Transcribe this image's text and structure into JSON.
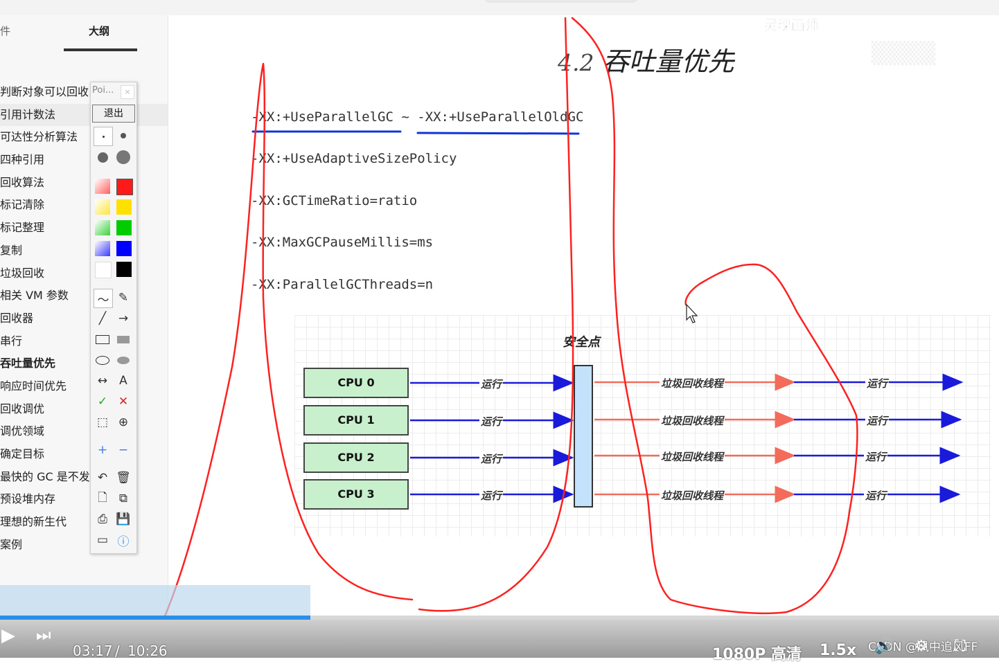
{
  "sidebar": {
    "tab_files": "件",
    "tab_outline": "大纲",
    "items": [
      "判断对象可以回收",
      "引用计数法",
      "可达性分析算法",
      "四种引用",
      "回收算法",
      "标记清除",
      "标记整理",
      "复制",
      "垃圾回收",
      "相关 VM 参数",
      "回收器",
      "串行",
      "吞吐量优先",
      "响应时间优先",
      "回收调优",
      "调优领域",
      "确定目标",
      "最快的 GC 是不发生",
      "预设堆内存",
      "理想的新生代",
      "案例"
    ]
  },
  "palette": {
    "title": "Poi...",
    "exit_label": "退出",
    "text_tool": "A",
    "colors": [
      "#ff1a1a",
      "#ffe000",
      "#00cc00",
      "#0000ff",
      "#ffffff",
      "#000000"
    ]
  },
  "slide": {
    "watermark": "灵魂画师",
    "title_num": "4.2",
    "title_text": "吞吐量优先",
    "params": [
      "-XX:+UseParallelGC ~ -XX:+UseParallelOldGC",
      "-XX:+UseAdaptiveSizePolicy",
      "-XX:GCTimeRatio=ratio",
      "-XX:MaxGCPauseMillis=ms",
      "-XX:ParallelGCThreads=n"
    ]
  },
  "diagram": {
    "safepoint_label": "安全点",
    "cpus": [
      "CPU 0",
      "CPU 1",
      "CPU 2",
      "CPU 3"
    ],
    "run_label": "运行",
    "gc_label": "垃圾回收线程",
    "colors": {
      "cpu_fill": "#c8f0cc",
      "run_arrow": "#1a1adb",
      "gc_arrow": "#f26b5b",
      "safepoint_fill": "#c4e2fb"
    }
  },
  "player": {
    "current_time": "03:17",
    "separator": "/",
    "total_time": "10:26",
    "progress": 0.311,
    "quality": "1080P 高清",
    "speed": "1.5x",
    "credit": "CSDN @风中追风FF"
  }
}
